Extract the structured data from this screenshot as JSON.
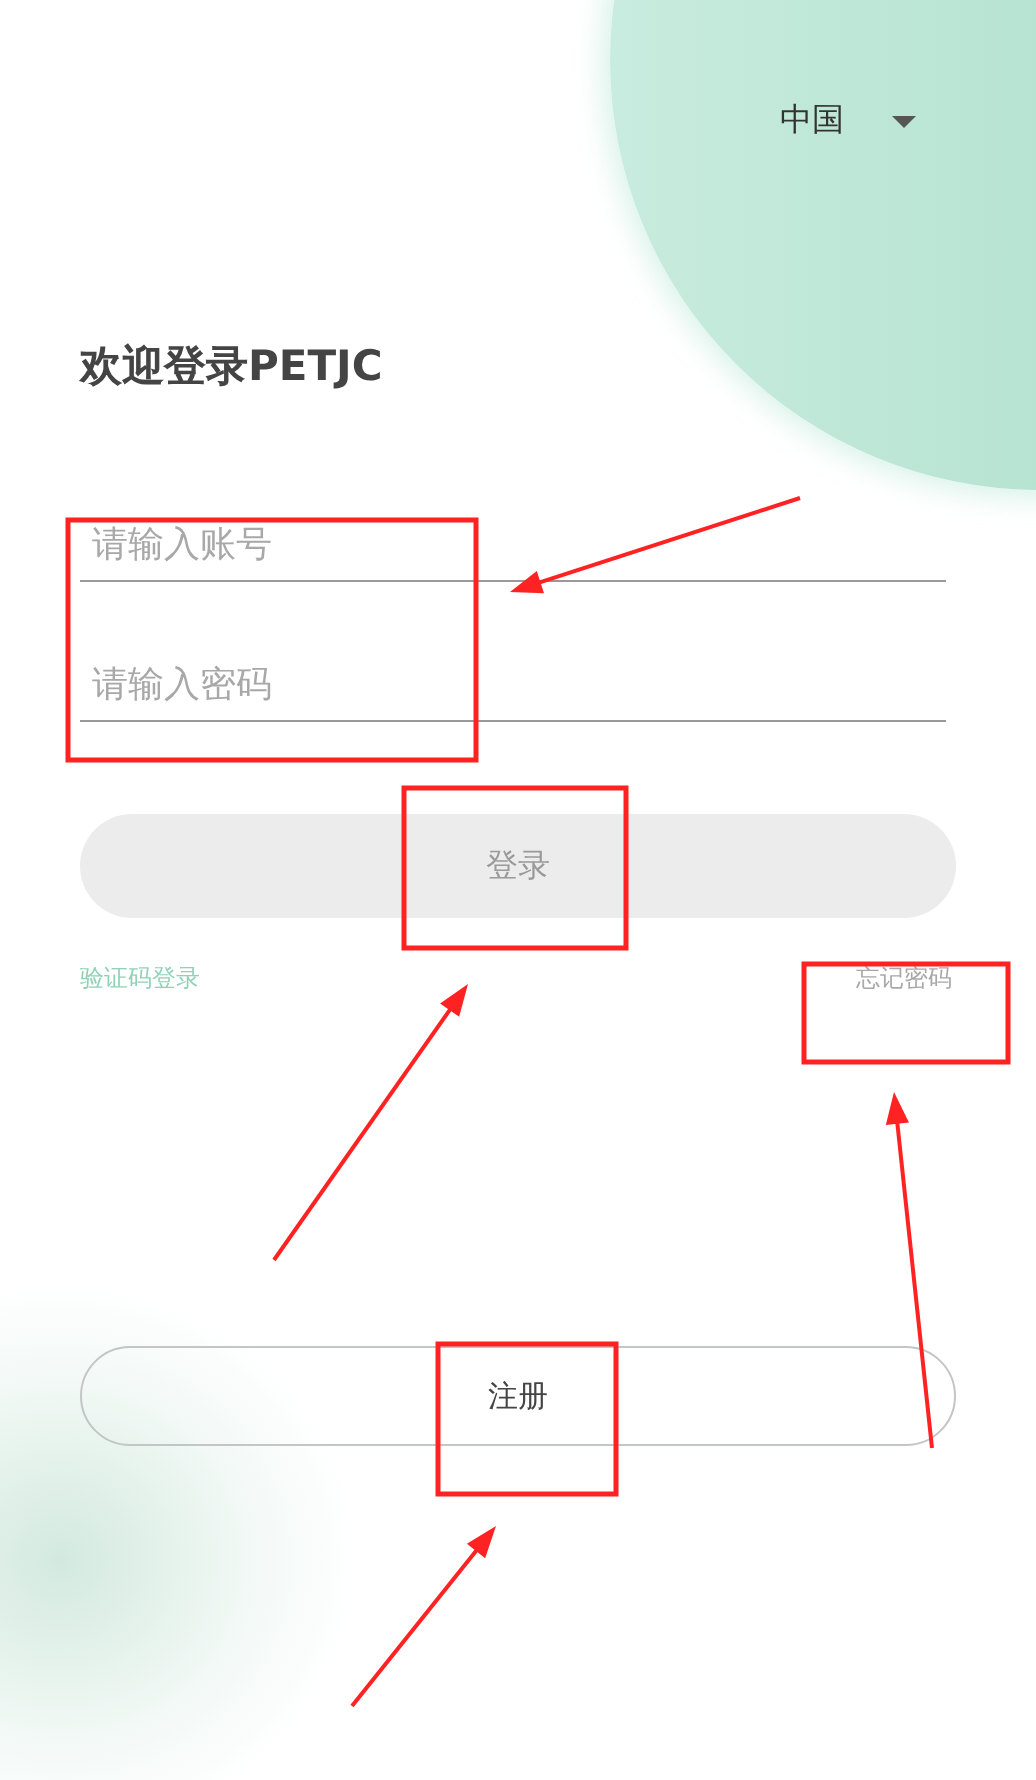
{
  "region_selector": {
    "value": "中国"
  },
  "title": "欢迎登录PETJC",
  "fields": [
    {
      "placeholder": "请输入账号"
    },
    {
      "placeholder": "请输入密码"
    }
  ],
  "login_button": {
    "label": "登录",
    "disabled": true
  },
  "links": [
    {
      "label": "验证码登录",
      "kind": "accent"
    },
    {
      "label": "忘记密码",
      "kind": "muted"
    }
  ],
  "register_button": {
    "label": "注册"
  }
}
